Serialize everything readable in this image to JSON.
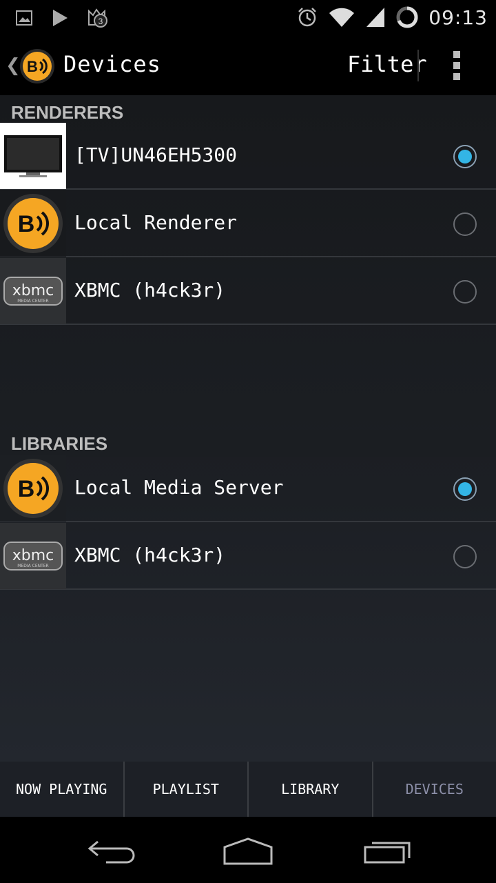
{
  "status_bar": {
    "time": "09:13",
    "notification_badge": "3",
    "icons": [
      "image-icon",
      "play-icon",
      "cat-notification-icon",
      "alarm-icon",
      "wifi-icon",
      "signal-icon",
      "sync-ring-icon"
    ]
  },
  "action_bar": {
    "title": "Devices",
    "filter_label": "Filter",
    "logo_text": "B"
  },
  "sections": {
    "renderers": {
      "header": "RENDERERS",
      "items": [
        {
          "label": "[TV]UN46EH5300",
          "thumb": "tv-icon",
          "selected": true
        },
        {
          "label": "Local Renderer",
          "thumb": "bubbleupnp-logo-icon",
          "selected": false
        },
        {
          "label": "XBMC (h4ck3r)",
          "thumb": "xbmc-logo-icon",
          "selected": false
        }
      ]
    },
    "libraries": {
      "header": "LIBRARIES",
      "items": [
        {
          "label": "Local Media Server",
          "thumb": "bubbleupnp-logo-icon",
          "selected": true
        },
        {
          "label": "XBMC (h4ck3r)",
          "thumb": "xbmc-logo-icon",
          "selected": false
        }
      ]
    }
  },
  "tabs": [
    {
      "label": "NOW PLAYING",
      "active": false
    },
    {
      "label": "PLAYLIST",
      "active": false
    },
    {
      "label": "LIBRARY",
      "active": false
    },
    {
      "label": "DEVICES",
      "active": true
    }
  ],
  "colors": {
    "accent_radio": "#33b5e5",
    "logo_orange": "#f5a623",
    "active_tab_text": "#8c8fa8"
  }
}
